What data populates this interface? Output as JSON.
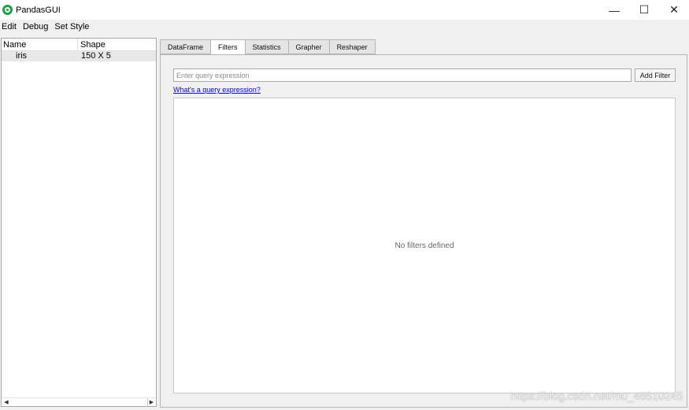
{
  "window": {
    "title": "PandasGUI",
    "controls": {
      "minimize": "—",
      "maximize": "☐",
      "close": "✕"
    }
  },
  "menu": [
    "Edit",
    "Debug",
    "Set Style"
  ],
  "navigator": {
    "columns": [
      "Name",
      "Shape"
    ],
    "rows": [
      {
        "name": "iris",
        "shape": "150 X 5"
      }
    ]
  },
  "tabs": [
    {
      "label": "DataFrame",
      "active": false
    },
    {
      "label": "Filters",
      "active": true
    },
    {
      "label": "Statistics",
      "active": false
    },
    {
      "label": "Grapher",
      "active": false
    },
    {
      "label": "Reshaper",
      "active": false
    }
  ],
  "filters": {
    "query_placeholder": "Enter query expression",
    "query_value": "",
    "add_button": "Add Filter",
    "help_link": "What's a query expression?",
    "empty_message": "No filters defined"
  },
  "watermark": "https://blog.csdn.net/m0_46510245",
  "colors": {
    "accent": "#19a34a",
    "link": "#0000ee"
  }
}
